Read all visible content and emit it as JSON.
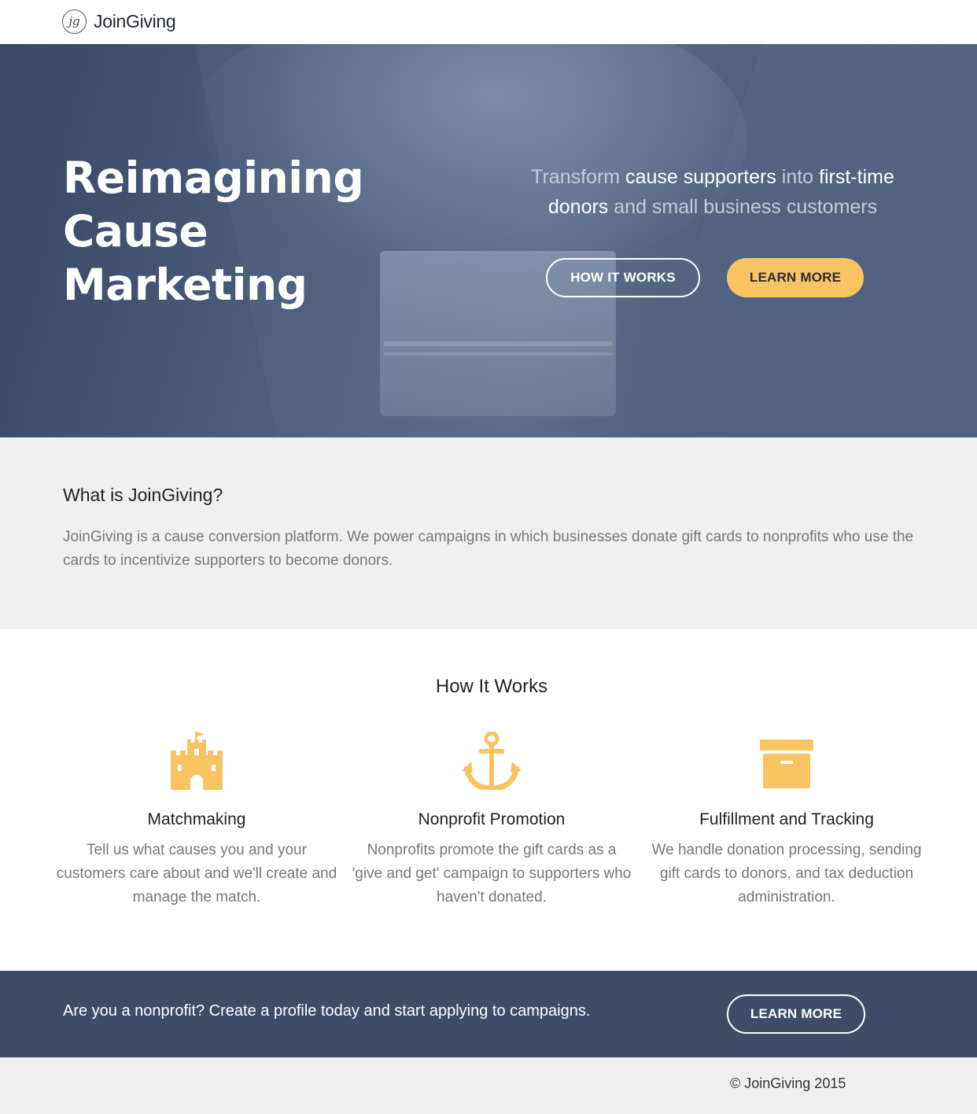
{
  "brand": {
    "name_light": "Join",
    "name_bold": "Giving",
    "logo_glyph": "jg"
  },
  "hero": {
    "title_line1": "Reimagining",
    "title_line2": "Cause",
    "title_line3": "Marketing",
    "tagline": {
      "p1": "Transform ",
      "p2": "cause supporters",
      "p3": " into ",
      "p4": "first-time donors",
      "p5": " and small business customers"
    },
    "how_button": "HOW IT WORKS",
    "learn_button": "LEARN MORE"
  },
  "what": {
    "heading": "What is JoinGiving?",
    "body": "JoinGiving is a cause conversion platform. We power campaigns in which businesses donate gift cards to nonprofits who use the cards to incentivize supporters to become donors."
  },
  "how": {
    "heading": "How It Works",
    "features": [
      {
        "icon": "castle-icon",
        "title": "Matchmaking",
        "body": "Tell us what causes you and your customers care about and we'll create and manage the match."
      },
      {
        "icon": "anchor-icon",
        "title": "Nonprofit Promotion",
        "body": "Nonprofits promote the gift cards as a 'give and get' campaign to supporters who haven't donated."
      },
      {
        "icon": "archive-box-icon",
        "title": "Fulfillment and Tracking",
        "body": "We handle donation processing, sending gift cards to donors, and tax deduction administration."
      }
    ]
  },
  "cta": {
    "text": "Are you a nonprofit? Create a profile today and start applying to campaigns.",
    "button": "LEARN MORE"
  },
  "footer": {
    "copyright": "© JoinGiving 2015"
  },
  "colors": {
    "accent": "#f8c463",
    "navy": "#3f4c68",
    "light_gray": "#f0f0f0"
  }
}
